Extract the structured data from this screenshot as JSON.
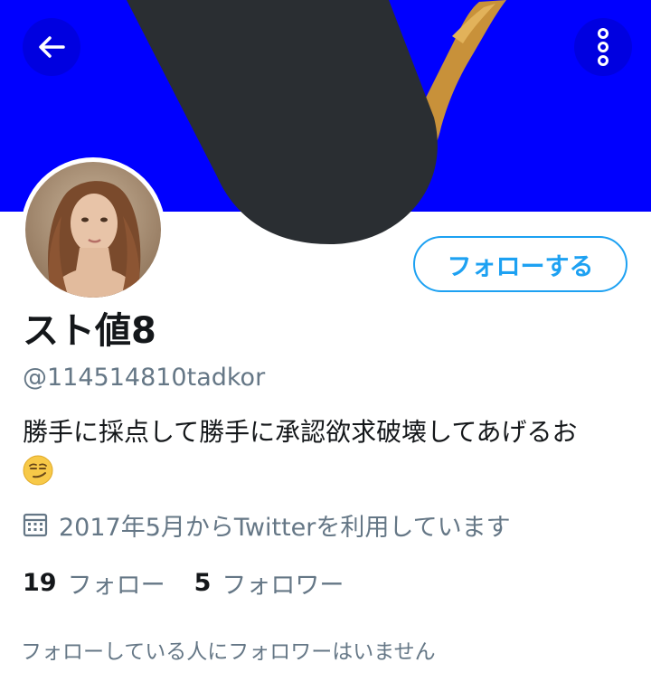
{
  "profile": {
    "display_name": "スト値8",
    "handle": "@114514810tadkor",
    "bio": "勝手に採点して勝手に承認欲求破壊してあげるお",
    "bio_emoji": "smirking-face-emoji",
    "joined": "2017年5月からTwitterを利用しています",
    "follow_button_label": "フォローする"
  },
  "stats": {
    "following_count": "19",
    "following_label": "フォロー",
    "followers_count": "5",
    "followers_label": "フォロワー"
  },
  "followers_note": "フォローしている人にフォロワーはいません",
  "icons": {
    "back": "arrow-left-icon",
    "more": "more-vertical-icon",
    "calendar": "calendar-icon"
  },
  "colors": {
    "banner": "#0000ff",
    "accent": "#1da1f2",
    "secondary_text": "#657786",
    "primary_text": "#14171a",
    "overlay_shape": "#2a2e32"
  }
}
